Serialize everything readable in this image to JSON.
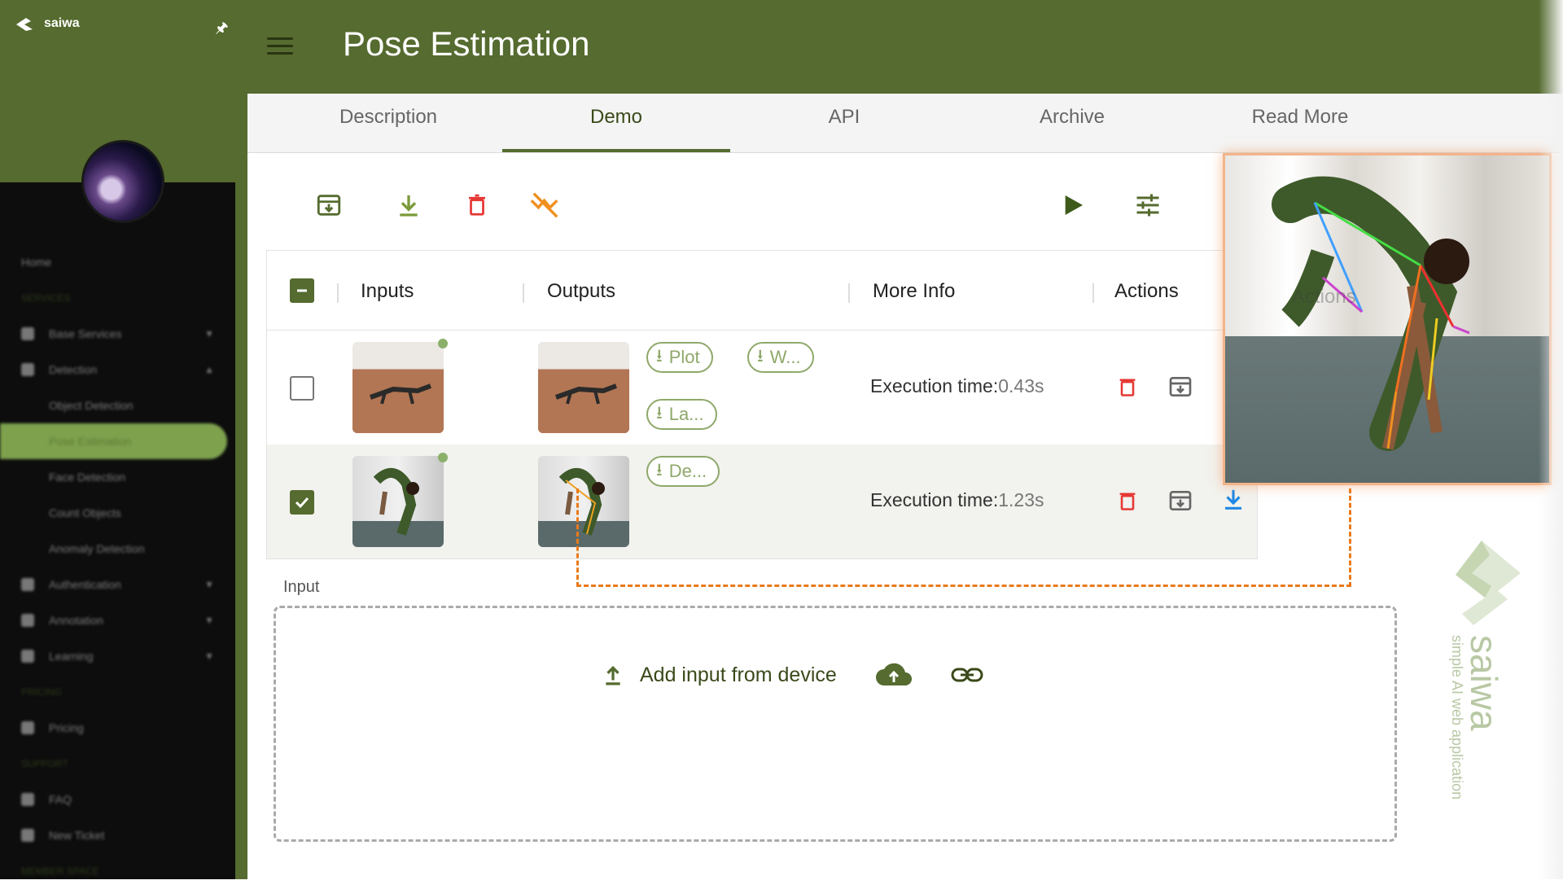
{
  "brand": {
    "name": "saiwa"
  },
  "header": {
    "title": "Pose Estimation"
  },
  "tabs": [
    {
      "label": "Description"
    },
    {
      "label": "Demo"
    },
    {
      "label": "API"
    },
    {
      "label": "Archive"
    },
    {
      "label": "Read More"
    }
  ],
  "sidebar": {
    "items": [
      {
        "label": "Home"
      },
      {
        "label": "SERVICES"
      },
      {
        "label": "Base Services"
      },
      {
        "label": "Detection"
      },
      {
        "label": "Object Detection"
      },
      {
        "label": "Pose Estimation"
      },
      {
        "label": "Face Detection"
      },
      {
        "label": "Count Objects"
      },
      {
        "label": "Anomaly Detection"
      },
      {
        "label": "Authentication"
      },
      {
        "label": "Annotation"
      },
      {
        "label": "Learning"
      },
      {
        "label": "PRICING"
      },
      {
        "label": "Pricing"
      },
      {
        "label": "SUPPORT"
      },
      {
        "label": "FAQ"
      },
      {
        "label": "New Ticket"
      },
      {
        "label": "MEMBER SPACE"
      }
    ]
  },
  "table": {
    "headers": {
      "inputs": "Inputs",
      "outputs": "Outputs",
      "more_info": "More Info",
      "actions": "Actions"
    },
    "rows": [
      {
        "chips": [
          "Plot",
          "W...",
          "La..."
        ],
        "exec_label": "Execution time:",
        "exec_value": "0.43s",
        "checked": false
      },
      {
        "chips": [
          "De..."
        ],
        "exec_label": "Execution time:",
        "exec_value": "1.23s",
        "checked": true
      }
    ]
  },
  "preview": {
    "overlay_text": "Actions"
  },
  "input": {
    "label": "Input",
    "add_label": "Add input from device"
  },
  "watermark": {
    "name": "saiwa",
    "tagline": "simple AI web application"
  },
  "colors": {
    "brand_green": "#556b2f",
    "danger": "#e53935",
    "accent_orange": "#f09020",
    "link_blue": "#1e88e5"
  }
}
